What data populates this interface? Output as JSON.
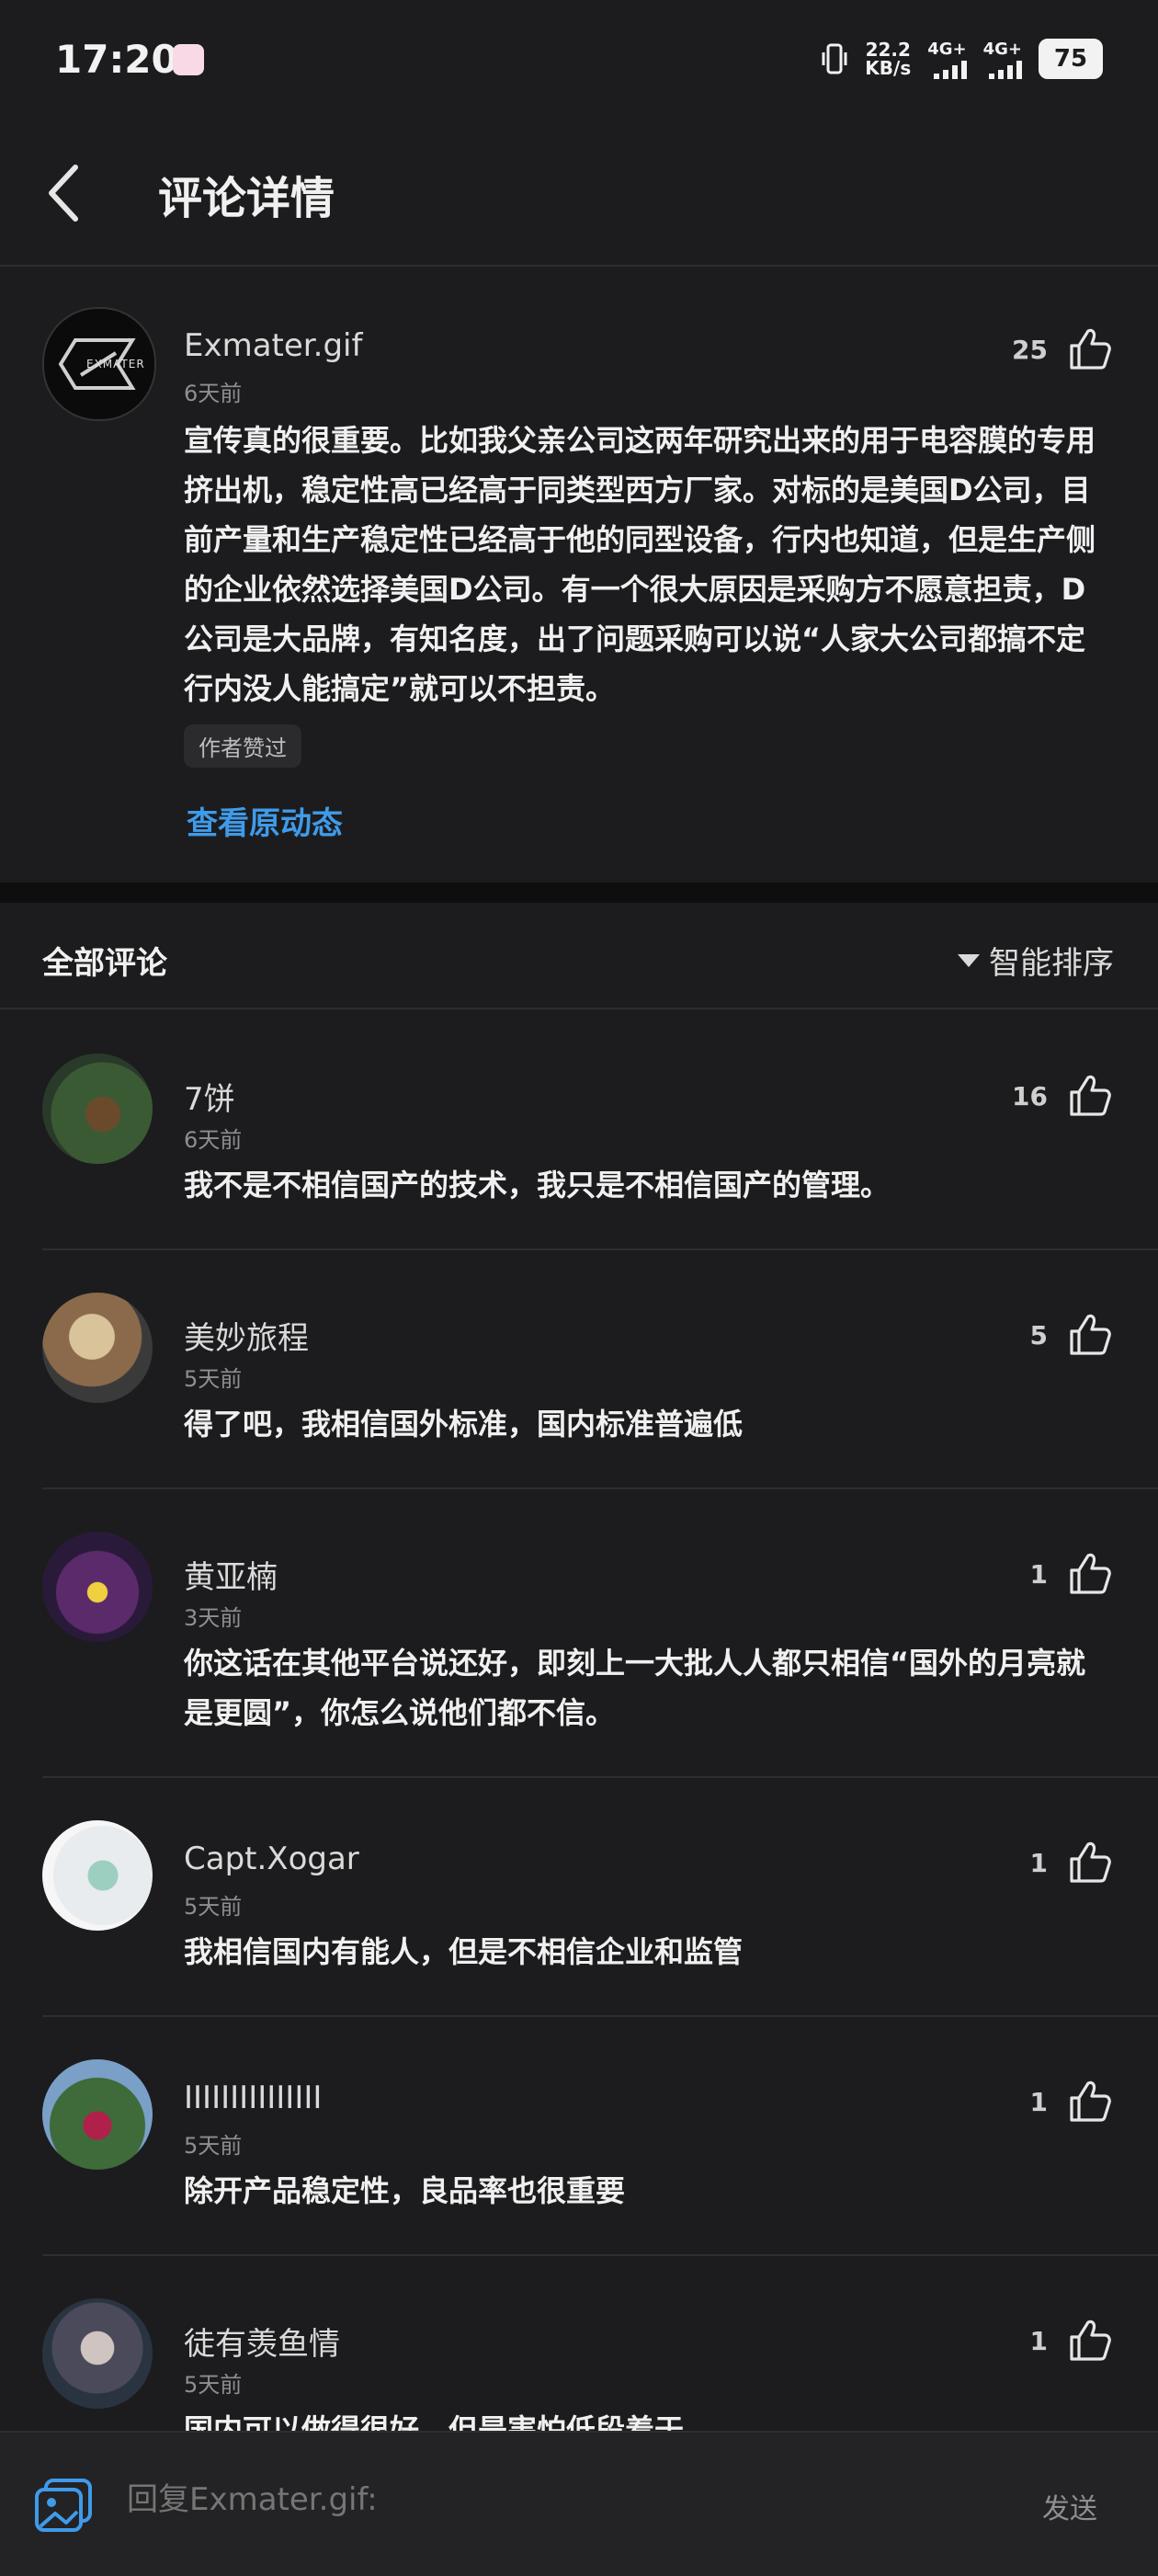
{
  "status_bar": {
    "time": "17:20",
    "speed_value": "22.2",
    "speed_unit": "KB/s",
    "net1": "4G+",
    "net2": "4G+",
    "battery": "75"
  },
  "header": {
    "title": "评论详情"
  },
  "main_comment": {
    "username": "Exmater.gif",
    "avatar_text": "EXMATER",
    "time": "6天前",
    "likes": "25",
    "text": "宣传真的很重要。比如我父亲公司这两年研究出来的用于电容膜的专用挤出机，稳定性高已经高于同类型西方厂家。对标的是美国D公司，目前产量和生产稳定性已经高于他的同型设备，行内也知道，但是生产侧的企业依然选择美国D公司。有一个很大原因是采购方不愿意担责，D公司是大品牌，有知名度，出了问题采购可以说“人家大公司都搞不定行内没人能搞定”就可以不担责。",
    "tag": "作者赞过",
    "view_original": "查看原动态"
  },
  "section": {
    "title": "全部评论",
    "sort_label": "智能排序"
  },
  "replies": [
    {
      "username": "7饼",
      "time": "6天前",
      "likes": "16",
      "text": "我不是不相信国产的技术，我只是不相信国产的管理。"
    },
    {
      "username": "美妙旅程",
      "time": "5天前",
      "likes": "5",
      "text": "得了吧，我相信国外标准，国内标准普遍低"
    },
    {
      "username": "黄亚楠",
      "time": "3天前",
      "likes": "1",
      "text": "你这话在其他平台说还好，即刻上一大批人人都只相信“国外的月亮就是更圆”，你怎么说他们都不信。"
    },
    {
      "username": "Capt.Xogar",
      "time": "5天前",
      "likes": "1",
      "text": "我相信国内有能人，但是不相信企业和监管"
    },
    {
      "username": "IIIIIIIIIIIIIII",
      "time": "5天前",
      "likes": "1",
      "text": "除开产品稳定性，良品率也很重要"
    },
    {
      "username": "徒有羡鱼情",
      "time": "5天前",
      "likes": "1",
      "text": "国内可以做得很好，但是害怕低段着于"
    }
  ],
  "bottom_bar": {
    "placeholder": "回复Exmater.gif:",
    "send_label": "发送"
  },
  "colors": {
    "background": "#1c1c1e",
    "link": "#3f9bea",
    "secondary_text": "#8e8e93"
  }
}
